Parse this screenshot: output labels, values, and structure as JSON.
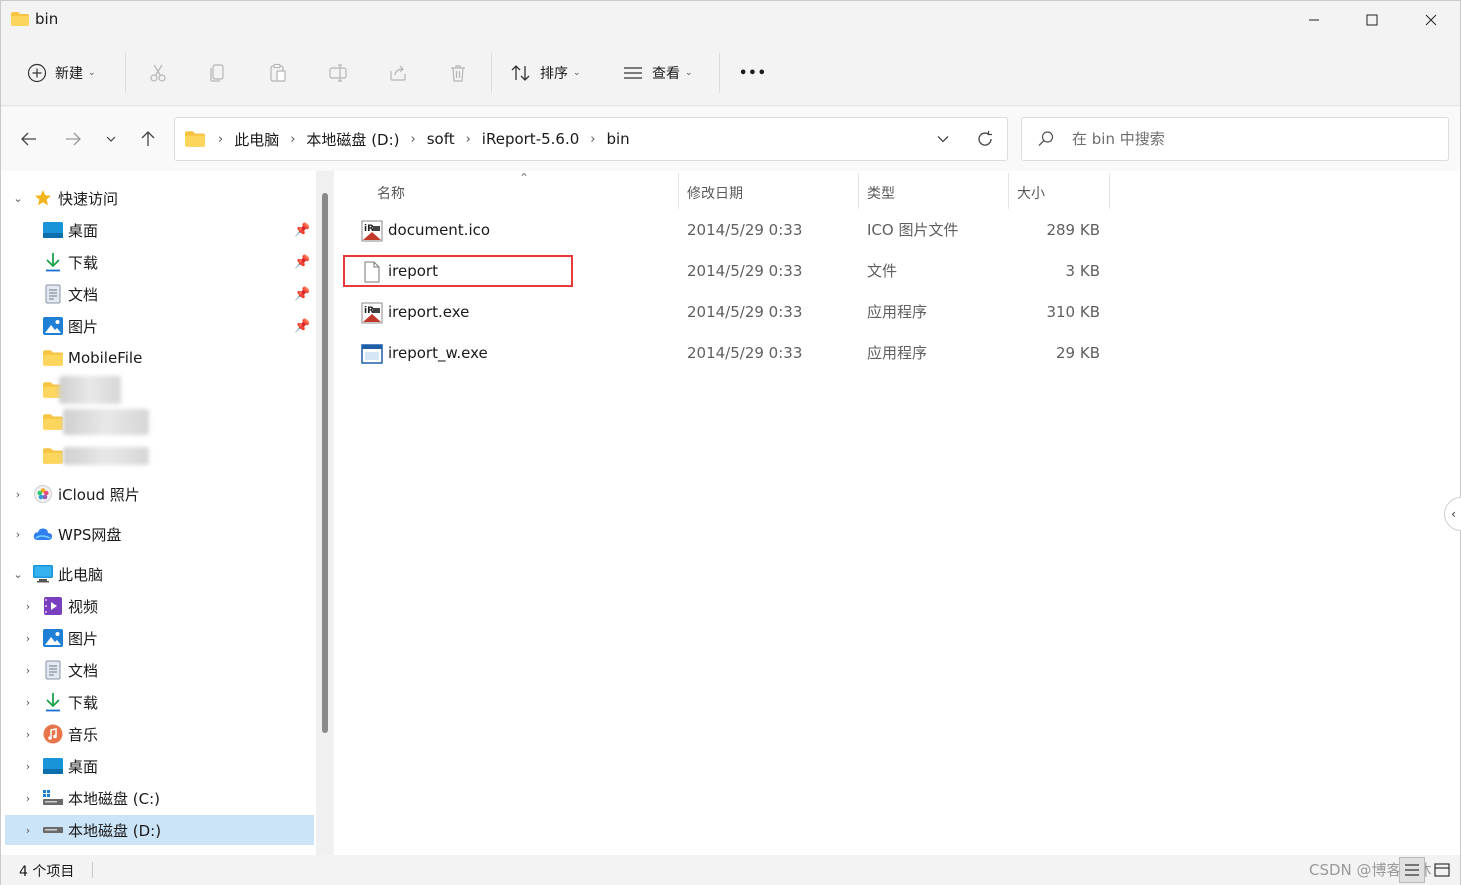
{
  "window": {
    "title": "bin",
    "controls": {
      "minimize": "minimize",
      "maximize": "maximize",
      "close": "close"
    }
  },
  "commandbar": {
    "new_label": "新建",
    "sort_label": "排序",
    "view_label": "查看",
    "more_label": "•••",
    "icons": [
      "cut-icon",
      "copy-icon",
      "paste-icon",
      "rename-icon",
      "share-icon",
      "delete-icon"
    ]
  },
  "address": {
    "crumbs": [
      "此电脑",
      "本地磁盘 (D:)",
      "soft",
      "iReport-5.6.0",
      "bin"
    ]
  },
  "search": {
    "placeholder": "在 bin 中搜索"
  },
  "sidebar": {
    "quick_access": "快速访问",
    "quick_items": [
      "桌面",
      "下载",
      "文档",
      "图片",
      "MobileFile"
    ],
    "icloud": "iCloud 照片",
    "wps": "WPS网盘",
    "this_pc": "此电脑",
    "pc_items": [
      "视频",
      "图片",
      "文档",
      "下载",
      "音乐",
      "桌面",
      "本地磁盘 (C:)",
      "本地磁盘 (D:)"
    ]
  },
  "columns": {
    "name": "名称",
    "date": "修改日期",
    "type": "类型",
    "size": "大小"
  },
  "files": [
    {
      "name": "document.ico",
      "date": "2014/5/29 0:33",
      "type": "ICO 图片文件",
      "size": "289 KB",
      "icon": "ireport-icon"
    },
    {
      "name": "ireport",
      "date": "2014/5/29 0:33",
      "type": "文件",
      "size": "3 KB",
      "icon": "blank-file-icon"
    },
    {
      "name": "ireport.exe",
      "date": "2014/5/29 0:33",
      "type": "应用程序",
      "size": "310 KB",
      "icon": "ireport-icon"
    },
    {
      "name": "ireport_w.exe",
      "date": "2014/5/29 0:33",
      "type": "应用程序",
      "size": "29 KB",
      "icon": "window-app-icon"
    }
  ],
  "status": {
    "item_count": "4 个项目"
  },
  "watermark": "CSDN @博客小沐",
  "colors": {
    "accent": "#0067c0",
    "selected_bg": "#cce4f7",
    "highlight_border": "#e83a3a",
    "folder": "#f6c343"
  }
}
